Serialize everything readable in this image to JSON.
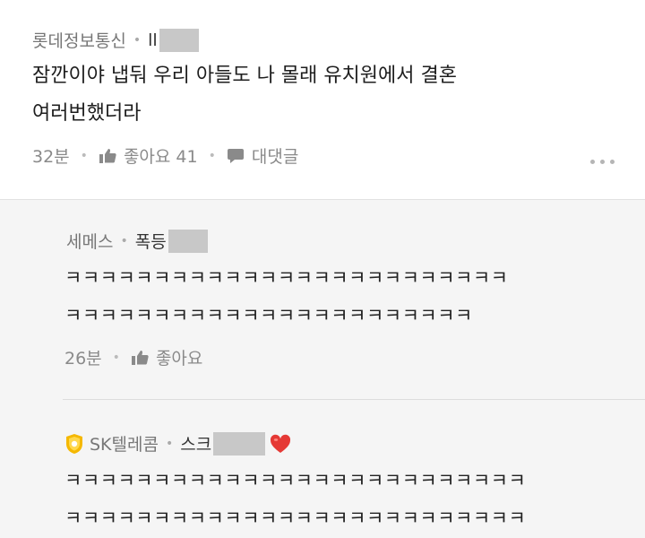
{
  "comments": [
    {
      "carrier": "롯데정보통신",
      "author_prefix": "ll",
      "text_lines": [
        "잠깐이야 냅둬 우리 아들도 나 몰래 유치원에서 결혼",
        "여러번했더라"
      ],
      "time": "32분",
      "like_label": "좋아요 41",
      "reply_label": "대댓글"
    }
  ],
  "replies": [
    {
      "carrier": "세메스",
      "author_prefix": "폭등",
      "text_lines": [
        "ㅋㅋㅋㅋㅋㅋㅋㅋㅋㅋㅋㅋㅋㅋㅋㅋㅋㅋㅋㅋㅋㅋㅋㅋㅋ",
        "ㅋㅋㅋㅋㅋㅋㅋㅋㅋㅋㅋㅋㅋㅋㅋㅋㅋㅋㅋㅋㅋㅋㅋ"
      ],
      "time": "26분",
      "like_label": "좋아요"
    },
    {
      "carrier": "SK텔레콤",
      "author_prefix": "스크",
      "badge_icon": "company-badge-icon",
      "author_suffix_icon": "heart-icon",
      "text_lines": [
        "ㅋㅋㅋㅋㅋㅋㅋㅋㅋㅋㅋㅋㅋㅋㅋㅋㅋㅋㅋㅋㅋㅋㅋㅋㅋㅋ",
        "ㅋㅋㅋㅋㅋㅋㅋㅋㅋㅋㅋㅋㅋㅋㅋㅋㅋㅋㅋㅋㅋㅋㅋㅋㅋㅋ"
      ]
    }
  ],
  "colors": {
    "heart": "#e53935",
    "badge": "#f5b800",
    "reply_background": "#f5f5f5"
  }
}
